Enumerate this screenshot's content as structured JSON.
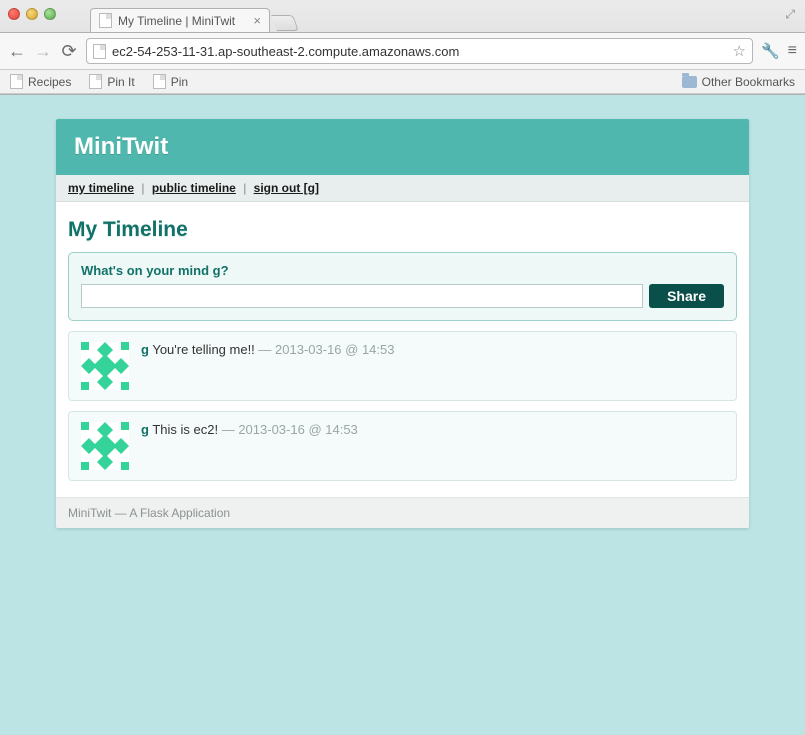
{
  "browser": {
    "tab_title": "My Timeline | MiniTwit",
    "url": "ec2-54-253-11-31.ap-southeast-2.compute.amazonaws.com",
    "bookmarks": {
      "items": [
        "Recipes",
        "Pin It",
        "Pin"
      ],
      "other": "Other Bookmarks"
    }
  },
  "app": {
    "title": "MiniTwit",
    "nav": {
      "my_timeline": "my timeline",
      "public_timeline": "public timeline",
      "sign_out": "sign out [g]"
    },
    "heading": "My Timeline",
    "composer": {
      "label": "What's on your mind g?",
      "value": "",
      "button": "Share"
    },
    "twits": [
      {
        "user": "g",
        "text": "You're telling me!!",
        "meta": "— 2013-03-16 @ 14:53"
      },
      {
        "user": "g",
        "text": "This is ec2!",
        "meta": "— 2013-03-16 @ 14:53"
      }
    ],
    "footer": "MiniTwit — A Flask Application"
  }
}
